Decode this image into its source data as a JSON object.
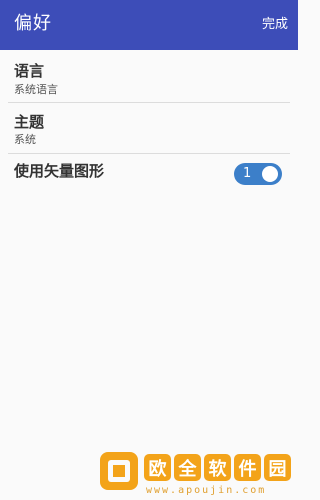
{
  "appbar": {
    "title": "偏好",
    "done_label": "完成"
  },
  "preferences": [
    {
      "label": "语言",
      "summary": "系统语言"
    },
    {
      "label": "主题",
      "summary": "系统"
    },
    {
      "label": "使用矢量图形",
      "toggle_value": "1",
      "toggle_on": true
    }
  ],
  "watermark": {
    "chars": [
      "欧",
      "全",
      "软",
      "件",
      "园"
    ],
    "url": "www.apoujin.com"
  },
  "colors": {
    "appbar": "#3d4db8",
    "toggle": "#3c7fc9",
    "watermark": "#f3a319"
  }
}
